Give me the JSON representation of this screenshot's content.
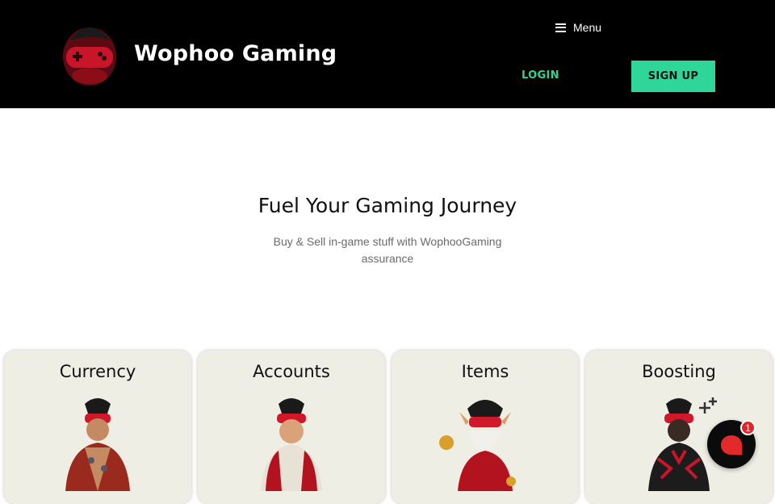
{
  "header": {
    "brand": "Wophoo Gaming",
    "menu_label": "Menu",
    "login_label": "LOGIN",
    "signup_label": "SIGN UP",
    "colors": {
      "background": "#000000",
      "accent": "#2fd69a",
      "logo_red": "#b3121f"
    }
  },
  "hero": {
    "title": "Fuel Your Gaming Journey",
    "subtitle": "Buy & Sell in-game stuff with WophooGaming assurance"
  },
  "categories": [
    {
      "label": "Currency",
      "icon": "currency-character-icon"
    },
    {
      "label": "Accounts",
      "icon": "accounts-character-icon"
    },
    {
      "label": "Items",
      "icon": "items-character-icon"
    },
    {
      "label": "Boosting",
      "icon": "boosting-character-icon"
    }
  ],
  "chat": {
    "badge_count": "1",
    "icon": "chat-bubble-icon"
  }
}
